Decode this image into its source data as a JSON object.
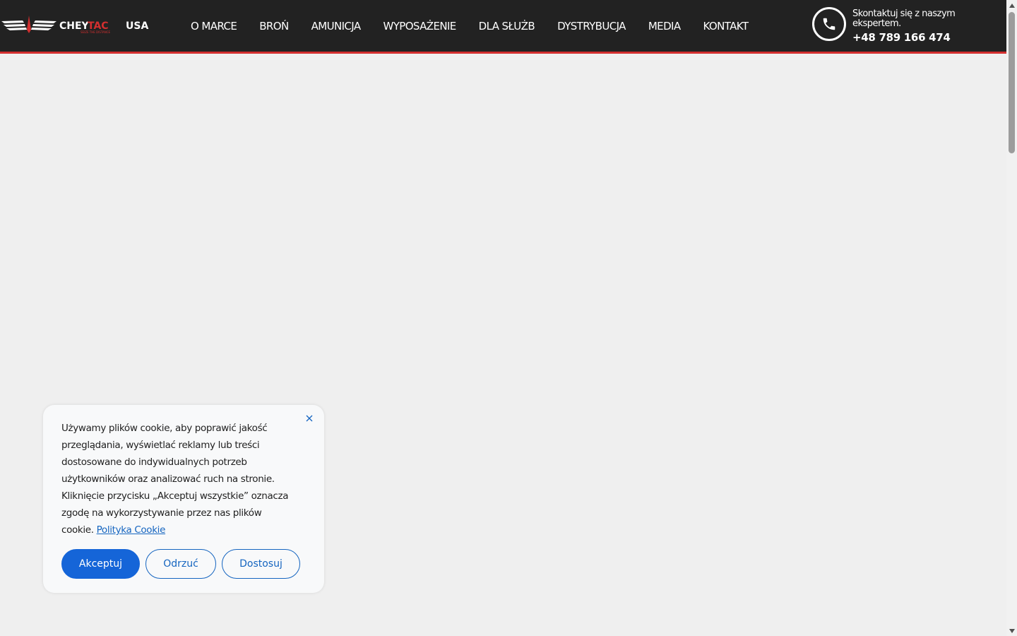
{
  "header": {
    "logo": {
      "brand_white_1": "CHEY",
      "brand_red": "TAC",
      "brand_white_2": "USA",
      "tagline": "SEIZE THE DISTANCE"
    },
    "nav": [
      "O MARCE",
      "BROŃ",
      "AMUNICJA",
      "WYPOSAŻENIE",
      "DLA SŁUŻB",
      "DYSTRYBUCJA",
      "MEDIA",
      "KONTAKT"
    ],
    "contact": {
      "icon": "phone-icon",
      "text": "Skontaktuj się z naszym ekspertem.",
      "phone": "+48 789 166 474"
    }
  },
  "cookie_banner": {
    "text": "Używamy plików cookie, aby poprawić jakość przeglądania, wyświetlać reklamy lub treści dostosowane do indywidualnych potrzeb użytkowników oraz analizować ruch na stronie. Kliknięcie przycisku „Akceptuj wszystkie” oznacza zgodę na wykorzystywanie przez nas plików cookie.",
    "link": "Polityka Cookie",
    "accept": "Akceptuj",
    "reject": "Odrzuć",
    "customize": "Dostosuj",
    "close_icon": "close-icon"
  },
  "colors": {
    "header_bg": "#222222",
    "accent_red": "#d32f2f",
    "page_bg": "#efefef",
    "primary_blue": "#1565d8"
  }
}
